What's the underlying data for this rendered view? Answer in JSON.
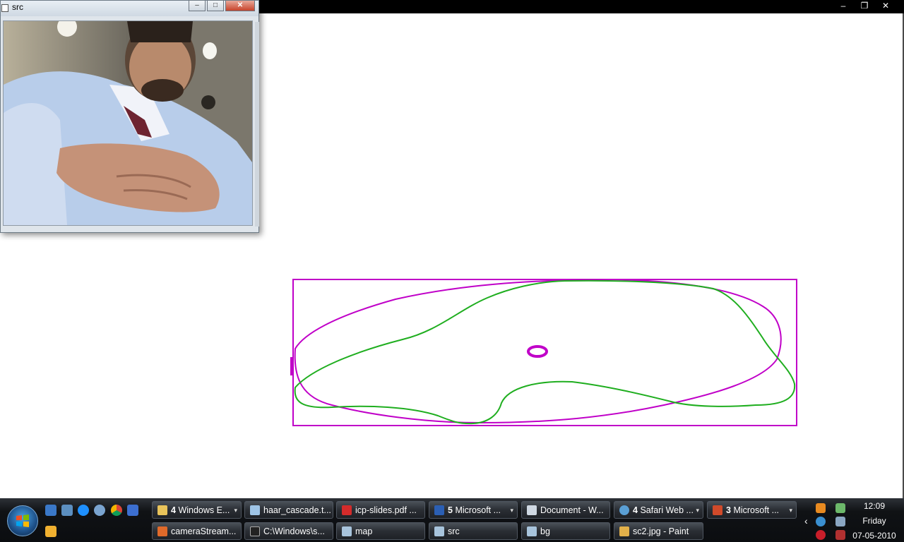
{
  "background_window": {
    "controls": [
      "–",
      "❐",
      "✕"
    ]
  },
  "src_window": {
    "title": "src",
    "controls": [
      "–",
      "□",
      "✕"
    ]
  },
  "taskbar": {
    "row1": [
      {
        "icon": "folder-icon",
        "count": "4",
        "label": "Windows E...",
        "arrow": "▾",
        "color": "#e8c35a"
      },
      {
        "icon": "notepad-icon",
        "count": "",
        "label": "haar_cascade.t...",
        "arrow": "",
        "color": "#9ec4e6"
      },
      {
        "icon": "pdf-icon",
        "count": "",
        "label": "icp-slides.pdf ...",
        "arrow": "",
        "color": "#d32b2b"
      },
      {
        "icon": "word-icon",
        "count": "5",
        "label": "Microsoft ...",
        "arrow": "▾",
        "color": "#2b5fb4"
      },
      {
        "icon": "document-icon",
        "count": "",
        "label": "Document - W...",
        "arrow": "",
        "color": "#cfd8e2"
      },
      {
        "icon": "safari-icon",
        "count": "4",
        "label": "Safari Web ...",
        "arrow": "▾",
        "color": "#5a9fd4"
      },
      {
        "icon": "acrobat-icon",
        "count": "3",
        "label": "Microsoft ...",
        "arrow": "▾",
        "color": "#d04a2a"
      }
    ],
    "row2": [
      {
        "icon": "camera-stream-icon",
        "label": "cameraStream...",
        "color": "#e06a2a"
      },
      {
        "icon": "cmd-icon",
        "label": "C:\\Windows\\s...",
        "color": "#222222"
      },
      {
        "icon": "window-icon",
        "label": "map",
        "color": "#a8c4dc"
      },
      {
        "icon": "window-icon",
        "label": "src",
        "color": "#a8c4dc"
      },
      {
        "icon": "window-icon",
        "label": "bg",
        "color": "#a8c4dc"
      },
      {
        "icon": "paint-icon",
        "label": "sc2.jpg - Paint",
        "color": "#e2b04a"
      }
    ],
    "clock": {
      "time": "12:09",
      "day": "Friday",
      "date": "07-05-2010"
    },
    "tray_expand": "‹"
  },
  "colors": {
    "magenta": "#c000c8",
    "green": "#1fae1f",
    "taskbar_bg": "#111317"
  }
}
